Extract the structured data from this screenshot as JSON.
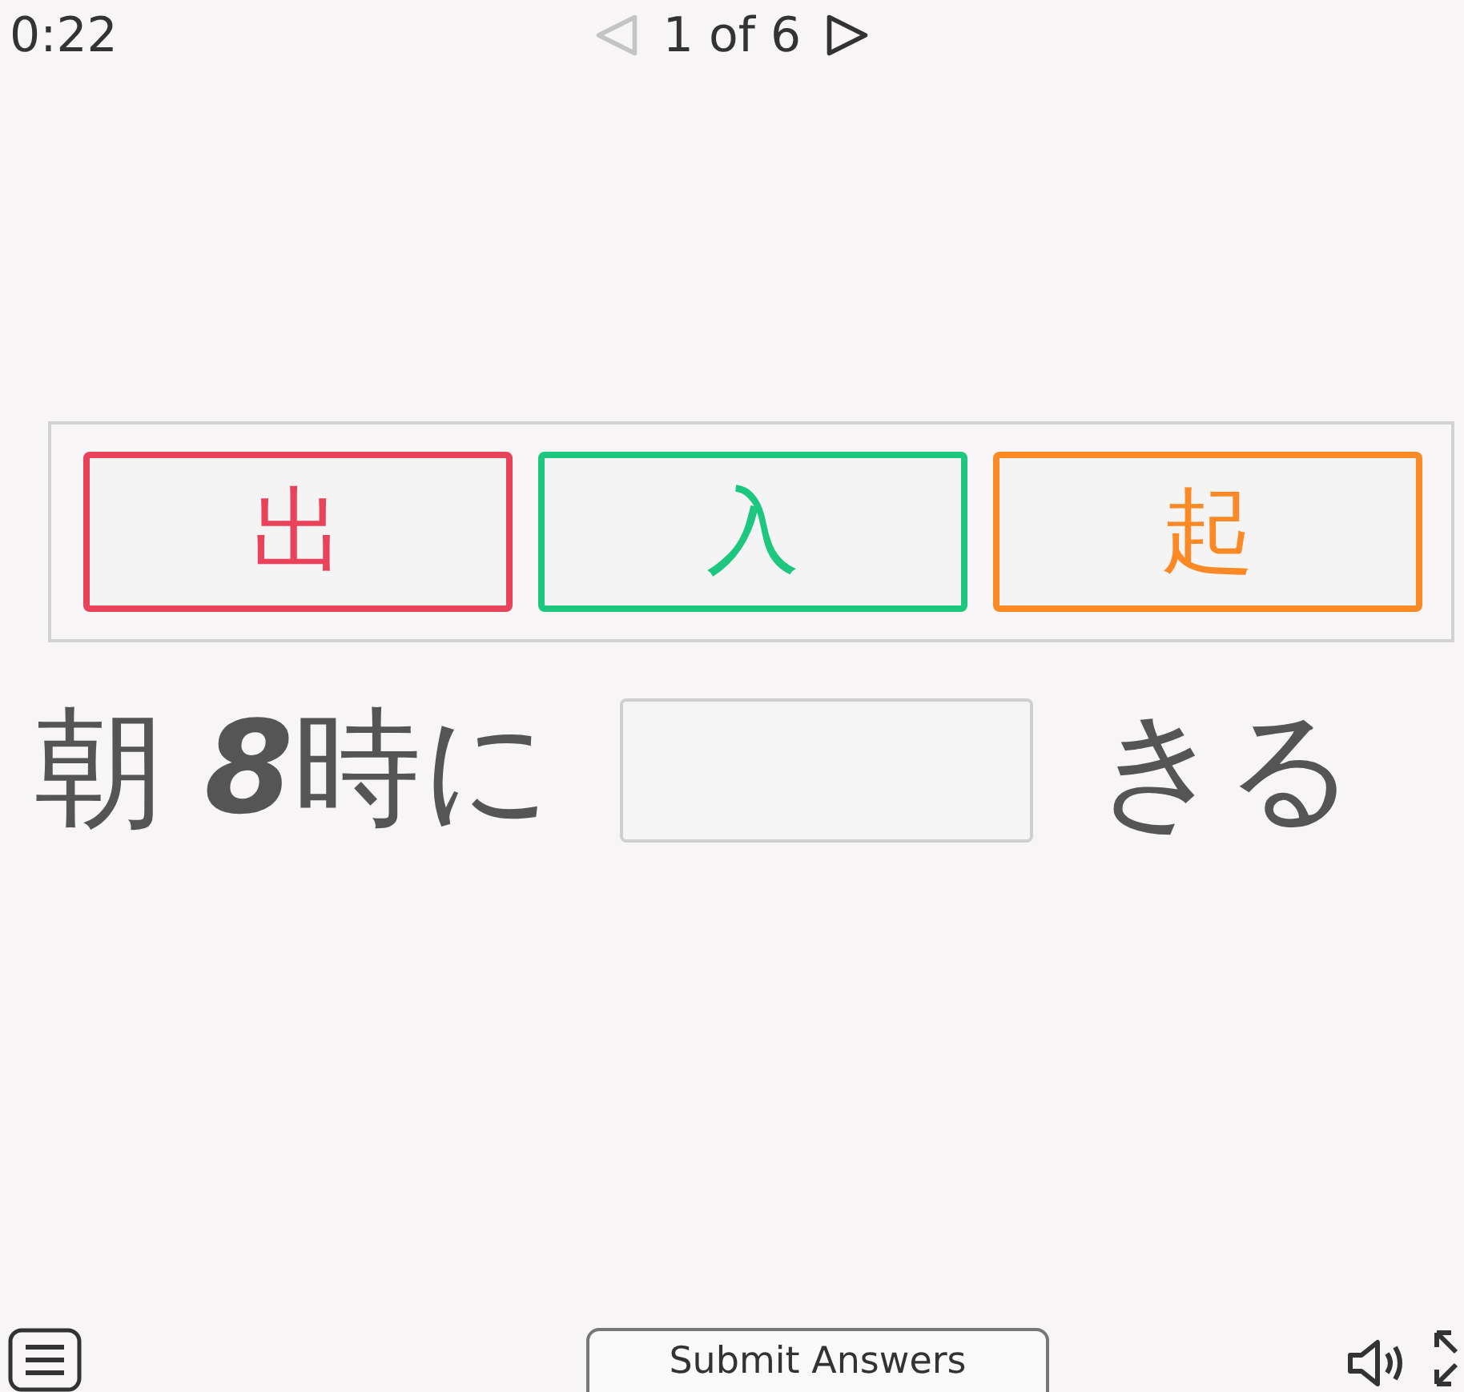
{
  "timer": "0:22",
  "pager": {
    "prev_disabled": true,
    "label": "1 of 6",
    "next_disabled": false
  },
  "tiles": [
    {
      "text": "出",
      "color": "#e8435a"
    },
    {
      "text": "入",
      "color": "#1ec77f"
    },
    {
      "text": "起",
      "color": "#fb8a26"
    }
  ],
  "sentence": {
    "before": "朝 **8**時に",
    "after": "きる"
  },
  "footer": {
    "submit": "Submit Answers"
  }
}
